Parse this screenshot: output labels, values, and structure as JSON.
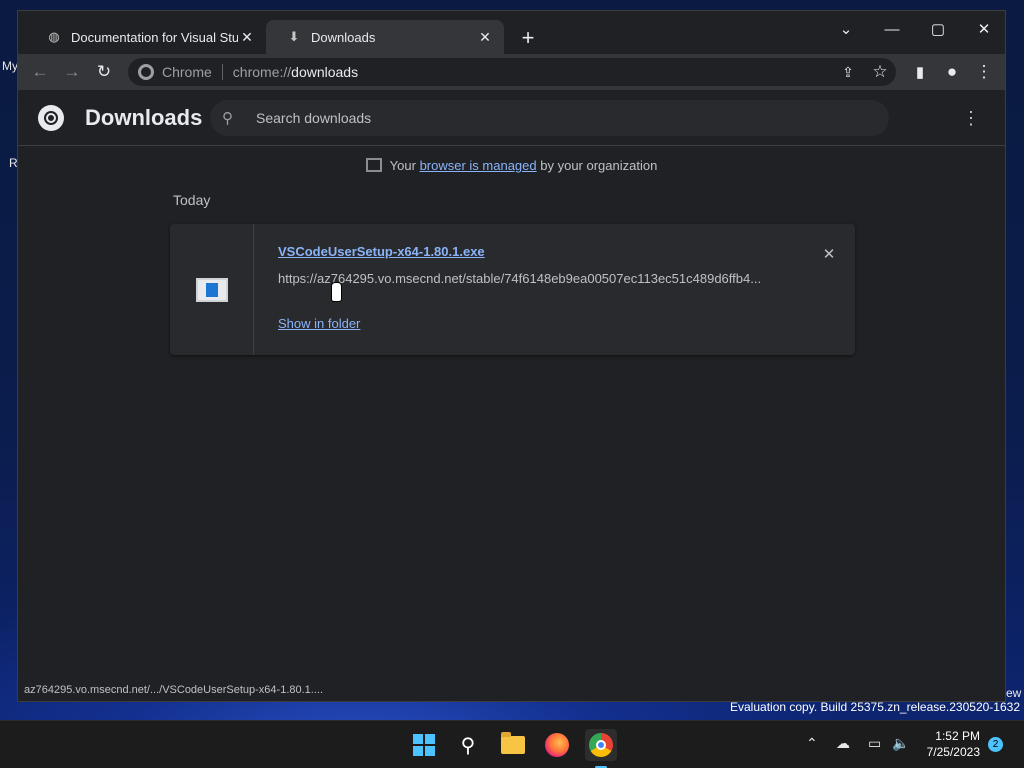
{
  "desktop": {
    "label_my": "My",
    "label_r": "R",
    "label_ew": "ew",
    "evaluation": "Evaluation copy. Build 25375.zn_release.230520-1632"
  },
  "tabs": [
    {
      "title": "Documentation for Visual Studio",
      "icon": "globe-icon"
    },
    {
      "title": "Downloads",
      "icon": "download-icon"
    }
  ],
  "omnibox": {
    "chip": "Chrome",
    "scheme": "chrome://",
    "path": "downloads"
  },
  "downloads": {
    "title": "Downloads",
    "search_placeholder": "Search downloads",
    "managed_prefix": "Your",
    "managed_link": "browser is managed",
    "managed_suffix": "by your organization",
    "section": "Today",
    "item": {
      "filename": "VSCodeUserSetup-x64-1.80.1.exe",
      "url": "https://az764295.vo.msecnd.net/stable/74f6148eb9ea00507ec113ec51c489d6ffb4...",
      "action": "Show in folder"
    }
  },
  "status_url": "az764295.vo.msecnd.net/.../VSCodeUserSetup-x64-1.80.1....",
  "clock": {
    "time": "1:52 PM",
    "date": "7/25/2023"
  },
  "notifications": "2"
}
